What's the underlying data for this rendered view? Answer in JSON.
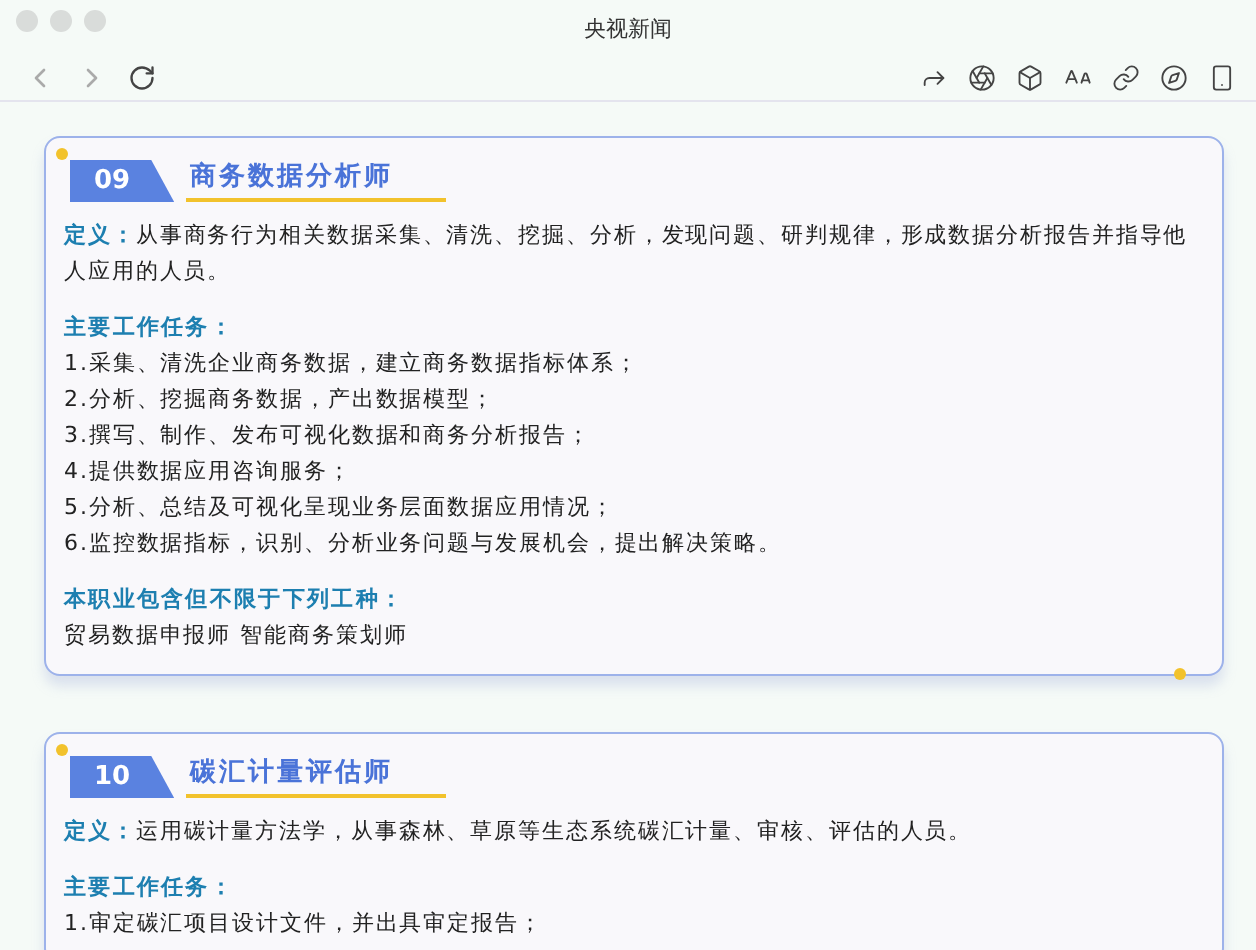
{
  "window": {
    "title": "央视新闻"
  },
  "cards": [
    {
      "number": "09",
      "title": "商务数据分析师",
      "definition_label": "定义：",
      "definition": "从事商务行为相关数据采集、清洗、挖掘、分析，发现问题、研判规律，形成数据分析报告并指导他人应用的人员。",
      "tasks_heading": "主要工作任务：",
      "tasks": [
        "1.采集、清洗企业商务数据，建立商务数据指标体系；",
        "2.分析、挖掘商务数据，产出数据模型；",
        "3.撰写、制作、发布可视化数据和商务分析报告；",
        "4.提供数据应用咨询服务；",
        "5.分析、总结及可视化呈现业务层面数据应用情况；",
        "6.监控数据指标，识别、分析业务问题与发展机会，提出解决策略。"
      ],
      "includes_heading": "本职业包含但不限于下列工种：",
      "includes": "贸易数据申报师 智能商务策划师"
    },
    {
      "number": "10",
      "title": "碳汇计量评估师",
      "definition_label": "定义：",
      "definition": "运用碳计量方法学，从事森林、草原等生态系统碳汇计量、审核、评估的人员。",
      "tasks_heading": "主要工作任务：",
      "tasks": [
        "1.审定碳汇项目设计文件，并出具审定报告；"
      ]
    }
  ]
}
